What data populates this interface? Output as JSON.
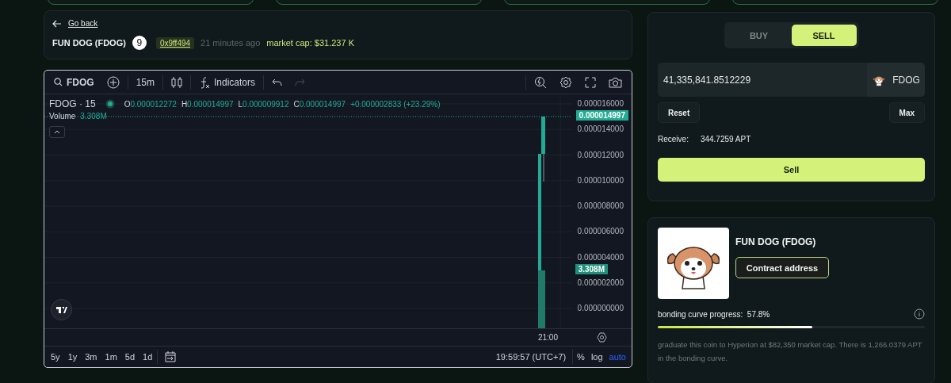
{
  "header": {
    "back_link": "Go back",
    "token_name": "FUN DOG (FDOG)",
    "badge": "9",
    "address": "0x9ff494",
    "age": "21 minutes ago",
    "market_cap": "market cap: $31.237 K"
  },
  "chart": {
    "symbol": "FDOG",
    "interval": "15m",
    "indicators": "Indicators",
    "legend_title": "FDOG · 15",
    "ohlc": [
      {
        "label": "O",
        "value": "0.000012272"
      },
      {
        "label": "H",
        "value": "0.000014997"
      },
      {
        "label": "L",
        "value": "0.000009912"
      },
      {
        "label": "C",
        "value": "0.000014997"
      }
    ],
    "change": "+0.000002833 (+23.29%)",
    "volume_label": "Volume",
    "volume_value": "3.308M",
    "price_labels": [
      "0.000016000",
      "0.000014000",
      "0.000012000",
      "0.000010000",
      "0.000008000",
      "0.000006000",
      "0.000004000",
      "0.000002000",
      "0.000000000"
    ],
    "last_price": "0.000014997",
    "volume_tag": "3.308M",
    "time_label": "21:00",
    "ranges": [
      "5y",
      "1y",
      "3m",
      "1m",
      "5d",
      "1d"
    ],
    "clock": "19:59:57 (UTC+7)",
    "scale_options": [
      {
        "label": "%",
        "selected": false
      },
      {
        "label": "log",
        "selected": false
      },
      {
        "label": "auto",
        "selected": true
      }
    ]
  },
  "trade": {
    "tabs": [
      {
        "label": "BUY",
        "selected": false
      },
      {
        "label": "SELL",
        "selected": true
      }
    ],
    "amount": "41,335,841.8512229",
    "token": "FDOG",
    "reset": "Reset",
    "max": "Max",
    "receive_label": "Receive:",
    "receive_value": "344.7259 APT",
    "submit": "Sell"
  },
  "info": {
    "name": "FUN DOG (FDOG)",
    "contract_button": "Contract address",
    "progress_label": "bonding curve progress:",
    "progress_value": "57.8%",
    "level": 0.578,
    "description": "graduate this coin to Hyperion at $82,350 market cap. There is 1,266.0379 APT in the bonding curve."
  }
}
